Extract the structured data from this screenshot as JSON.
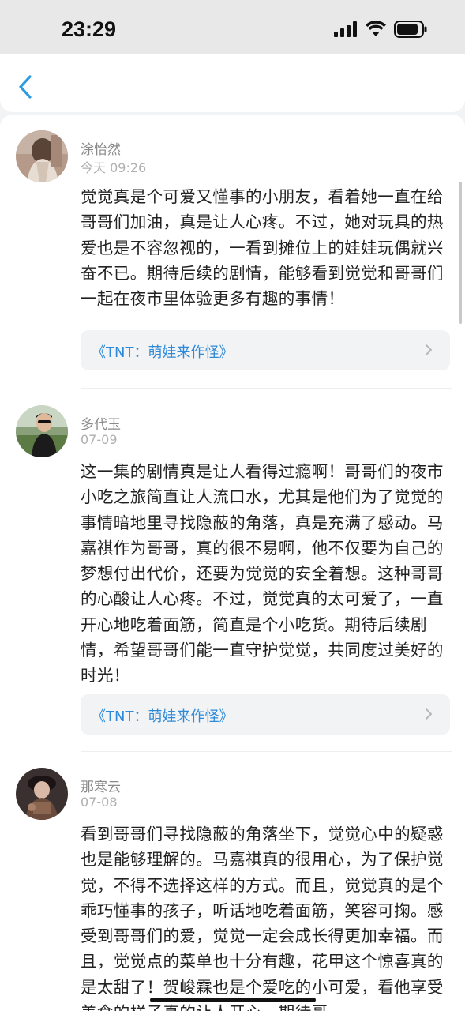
{
  "status_bar": {
    "time": "23:29"
  },
  "comments": [
    {
      "user": "涂怡然",
      "time": "今天 09:26",
      "text": "觉觉真是个可爱又懂事的小朋友，看着她一直在给哥哥们加油，真是让人心疼。不过，她对玩具的热爱也是不容忽视的，一看到摊位上的娃娃玩偶就兴奋不已。期待后续的剧情，能够看到觉觉和哥哥们一起在夜市里体验更多有趣的事情！",
      "link": "《TNT：萌娃来作怪》"
    },
    {
      "user": "多代玉",
      "time": "07-09",
      "text": "这一集的剧情真是让人看得过瘾啊！哥哥们的夜市小吃之旅简直让人流口水，尤其是他们为了觉觉的事情暗地里寻找隐蔽的角落，真是充满了感动。马嘉祺作为哥哥，真的很不易啊，他不仅要为自己的梦想付出代价，还要为觉觉的安全着想。这种哥哥的心酸让人心疼。不过，觉觉真的太可爱了，一直开心地吃着面筋，简直是个小吃货。期待后续剧情，希望哥哥们能一直守护觉觉，共同度过美好的时光！",
      "link": "《TNT：萌娃来作怪》"
    },
    {
      "user": "那寒云",
      "time": "07-08",
      "text": "看到哥哥们寻找隐蔽的角落坐下，觉觉心中的疑惑也是能够理解的。马嘉祺真的很用心，为了保护觉觉，不得不选择这样的方式。而且，觉觉真的是个乖巧懂事的孩子，听话地吃着面筋，笑容可掬。感受到哥哥们的爱，觉觉一定会成长得更加幸福。而且，觉觉点的菜单也十分有趣，花甲这个惊喜真的是太甜了！贺峻霖也是个爱吃的小可爱，看他享受美食的样子真的让人开心。期待哥"
    }
  ],
  "colors": {
    "link": "#2e8ad8",
    "back": "#2e9ae0"
  }
}
